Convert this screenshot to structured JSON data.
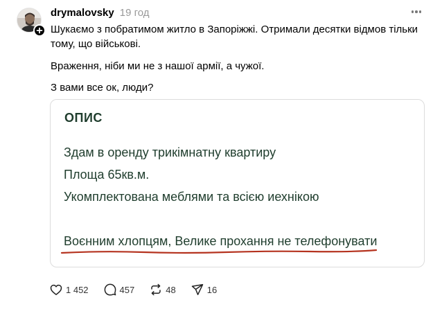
{
  "post": {
    "username": "drymalovsky",
    "time": "19 год",
    "text": [
      "Шукаємо з побратимом житло в Запоріжжі. Отримали десятки відмов тільки тому, що військові.",
      "Враження, ніби ми не з нашої армії, а чужої.",
      "З вами все ок, люди?"
    ]
  },
  "card": {
    "title": "ОПИС",
    "lines": [
      "Здам в оренду трикімнатну квартиру",
      "Площа 65кв.м.",
      "Укомплектована меблями та всією иехнікою",
      "Воєнним хлопцям, Велике прохання не телефонувати"
    ]
  },
  "actions": {
    "likes": "1 452",
    "replies": "457",
    "reposts": "48",
    "shares": "16"
  },
  "colors": {
    "card_text": "#1f3d2d",
    "underline": "#b5331f",
    "muted": "#999999"
  },
  "icons": [
    "avatar",
    "plus-icon",
    "more-icon",
    "heart-icon",
    "comment-icon",
    "repost-icon",
    "share-icon"
  ]
}
